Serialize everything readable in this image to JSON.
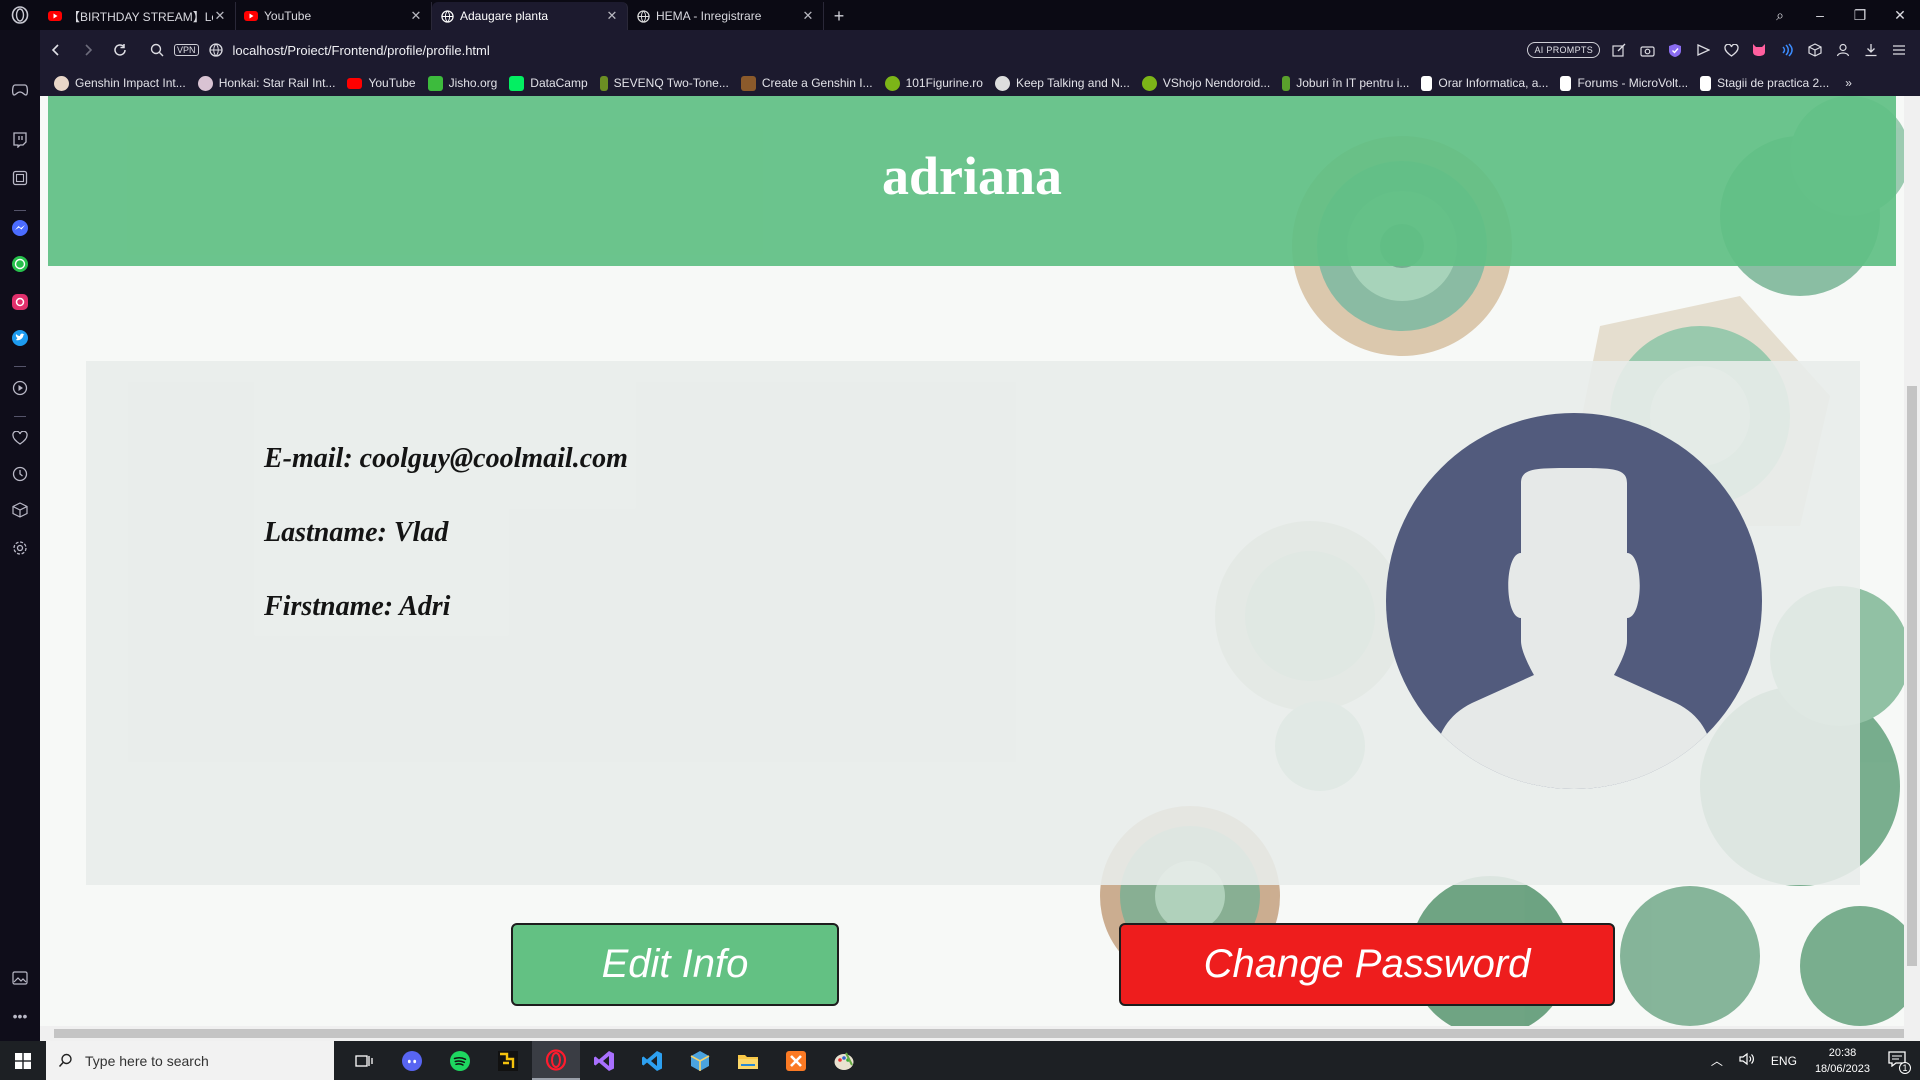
{
  "tabs": [
    {
      "title": "【BIRTHDAY STREAM】Let's P",
      "icon": "youtube-icon",
      "active": false
    },
    {
      "title": "YouTube",
      "icon": "youtube-icon",
      "active": false
    },
    {
      "title": "Adaugare planta",
      "icon": "globe-icon",
      "active": true
    },
    {
      "title": "HEMA - Inregistrare",
      "icon": "globe-icon",
      "active": false
    }
  ],
  "address": {
    "vpn": "VPN",
    "url": "localhost/Proiect/Frontend/profile/profile.html",
    "ai_prompts": "AI PROMPTS"
  },
  "bookmarks": [
    {
      "label": "Genshin Impact Int...",
      "color": "#e8d6c8"
    },
    {
      "label": "Honkai: Star Rail Int...",
      "color": "#d9c3d3"
    },
    {
      "label": "YouTube",
      "color": "#ff0000"
    },
    {
      "label": "Jisho.org",
      "color": "#3dbb3d"
    },
    {
      "label": "DataCamp",
      "color": "#03ef62"
    },
    {
      "label": "SEVENQ Two-Tone...",
      "color": "#6b8e23"
    },
    {
      "label": "Create a Genshin I...",
      "color": "#8b5a2b"
    },
    {
      "label": "101Figurine.ro",
      "color": "#7cb518"
    },
    {
      "label": "Keep Talking and N...",
      "color": "#dddddd"
    },
    {
      "label": "VShojo Nendoroid...",
      "color": "#7cb518"
    },
    {
      "label": "Joburi în IT pentru i...",
      "color": "#5aa02c"
    },
    {
      "label": "Orar Informatica, a...",
      "color": "#ffffff"
    },
    {
      "label": "Forums - MicroVolt...",
      "color": "#ffffff"
    },
    {
      "label": "Stagii de practica 2...",
      "color": "#ffffff"
    }
  ],
  "profile": {
    "username": "adriana",
    "email_line": "E-mail: coolguy@coolmail.com",
    "lastname_line": "Lastname: Vlad",
    "firstname_line": "Firstname: Adri",
    "edit_label": "Edit Info",
    "password_label": "Change Password"
  },
  "taskbar": {
    "search_placeholder": "Type here to search",
    "language": "ENG",
    "time": "20:38",
    "date": "18/06/2023",
    "notification_count": "1"
  },
  "colors": {
    "header_green": "#60c084",
    "edit_green": "#63c183",
    "password_red": "#ee1d1d",
    "avatar_blue": "#525b7d"
  }
}
